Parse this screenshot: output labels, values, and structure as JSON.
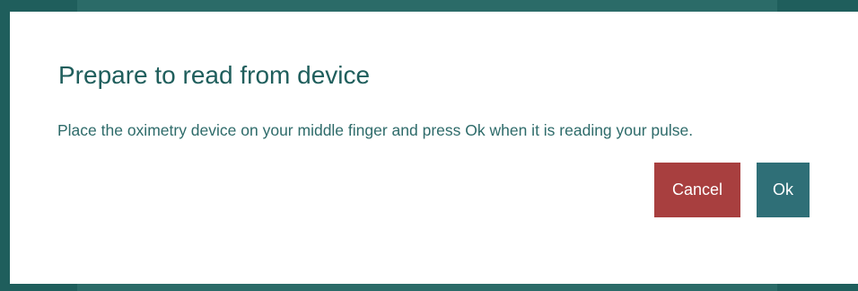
{
  "dialog": {
    "title": "Prepare to read from device",
    "message": "Place the oximetry device on your middle finger and press Ok when it is reading your pulse.",
    "cancel_label": "Cancel",
    "ok_label": "Ok"
  },
  "colors": {
    "backdrop": "#1f5e5c",
    "title": "#1f5e5c",
    "message": "#2e6b6a",
    "cancel_button": "#a83f3f",
    "ok_button": "#2f6f77"
  }
}
